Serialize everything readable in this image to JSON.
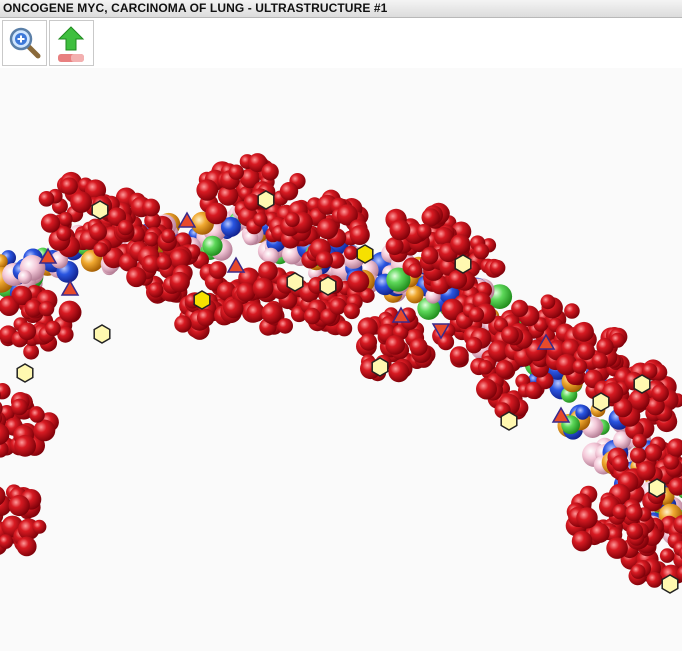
{
  "window": {
    "title": "ONCOGENE MYC, CARCINOMA OF LUNG - ULTRASTRUCTURE #1"
  },
  "toolbar": {
    "buttons": [
      {
        "icon": "zoom-in-magnifier-icon"
      },
      {
        "icon": "arrow-up-eraser-icon"
      }
    ]
  },
  "viewer": {
    "image": "dna-double-helix-molecular-model",
    "colors": {
      "backbone_red": "#c8101c",
      "base_blue": "#2a55e0",
      "base_green": "#5ed85a",
      "base_orange": "#f0a830",
      "base_pink": "#f4c8d8",
      "marker_yellow": "#fff8b0",
      "marker_triangle": "#e84a2a"
    },
    "markers": {
      "hexagon_count": 17,
      "triangle_count": 8
    }
  }
}
